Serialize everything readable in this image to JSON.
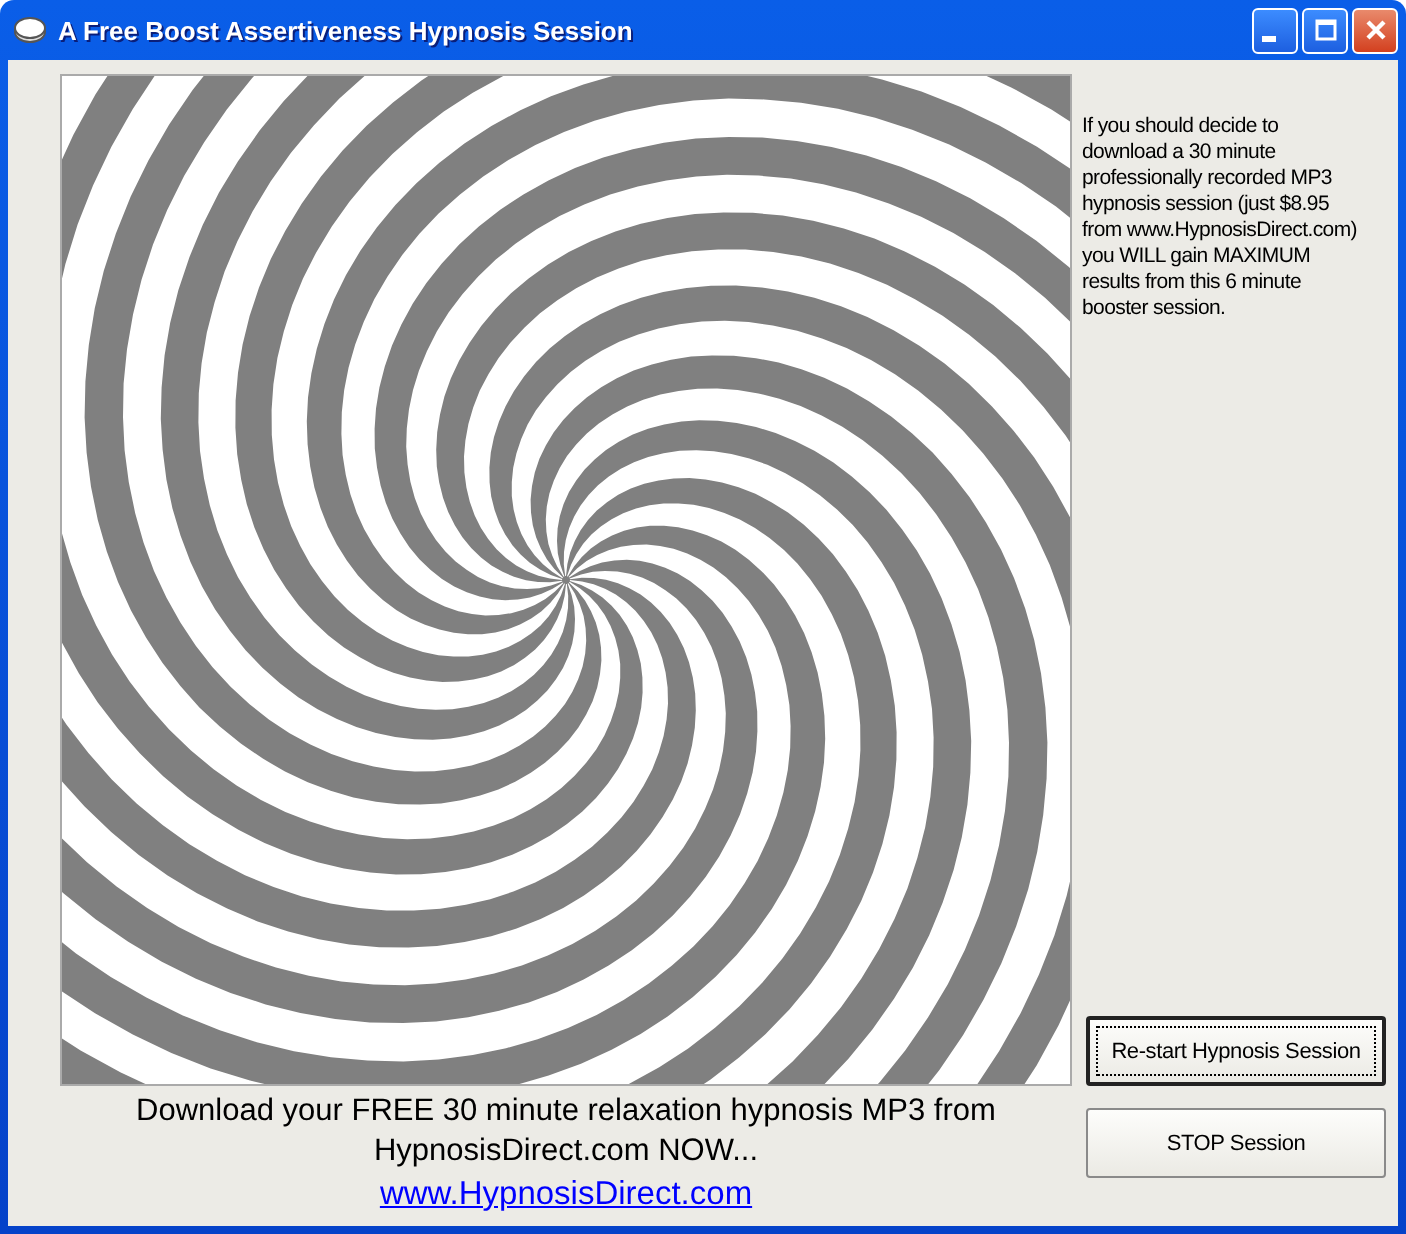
{
  "window": {
    "title": "A Free Boost Assertiveness Hypnosis Session"
  },
  "info_text": "If you should decide to download a 30 minute professionally recorded MP3 hypnosis session (just $8.95 from www.HypnosisDirect.com) you WILL gain MAXIMUM results from this 6 minute booster session.",
  "buttons": [
    {
      "label": "Re-start Hypnosis Session",
      "selected": true
    },
    {
      "label": "STOP Session",
      "selected": false
    }
  ],
  "promo_text": "Download your FREE 30 minute relaxation hypnosis MP3 from HypnosisDirect.com NOW...",
  "link": "www.HypnosisDirect.com"
}
